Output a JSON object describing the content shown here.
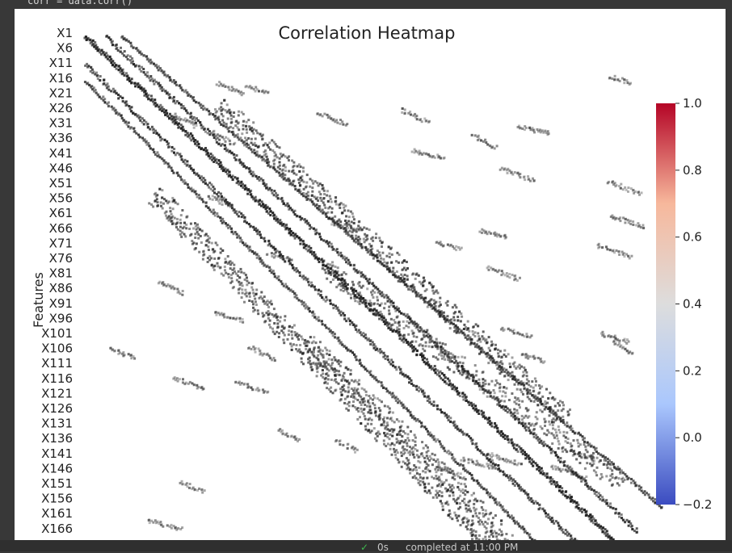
{
  "code_cell": {
    "text": "corr = data.corr()"
  },
  "chart_data": {
    "type": "heatmap",
    "title": "Correlation Heatmap",
    "xlabel": "",
    "ylabel": "Features",
    "y_tick_labels": [
      "X1",
      "X6",
      "X11",
      "X16",
      "X21",
      "X26",
      "X31",
      "X36",
      "X41",
      "X46",
      "X51",
      "X56",
      "X61",
      "X66",
      "X71",
      "X76",
      "X81",
      "X86",
      "X91",
      "X96",
      "X101",
      "X106",
      "X111",
      "X116",
      "X121",
      "X126",
      "X131",
      "X136",
      "X141",
      "X146",
      "X151",
      "X156",
      "X161",
      "X166"
    ],
    "colorbar": {
      "range": [
        -0.2,
        1.0
      ],
      "ticks": [
        1.0,
        0.8,
        0.6,
        0.4,
        0.2,
        0.0,
        -0.2
      ],
      "tick_labels": [
        "1.0",
        "0.8",
        "0.6",
        "0.4",
        "0.2",
        "0.0",
        "−0.2"
      ],
      "colormap": "coolwarm",
      "colors": [
        "#3b4cc0",
        "#aac7fd",
        "#dddddd",
        "#f7b89c",
        "#b40426"
      ]
    },
    "annotations": "cell values annotated in dark text (annot=True)",
    "diagonal_value": 1.0,
    "grid": false,
    "legend": "colorbar right"
  },
  "status_bar": {
    "check_icon": "check-icon",
    "duration": "0s",
    "completed": "completed at 11:00 PM"
  }
}
